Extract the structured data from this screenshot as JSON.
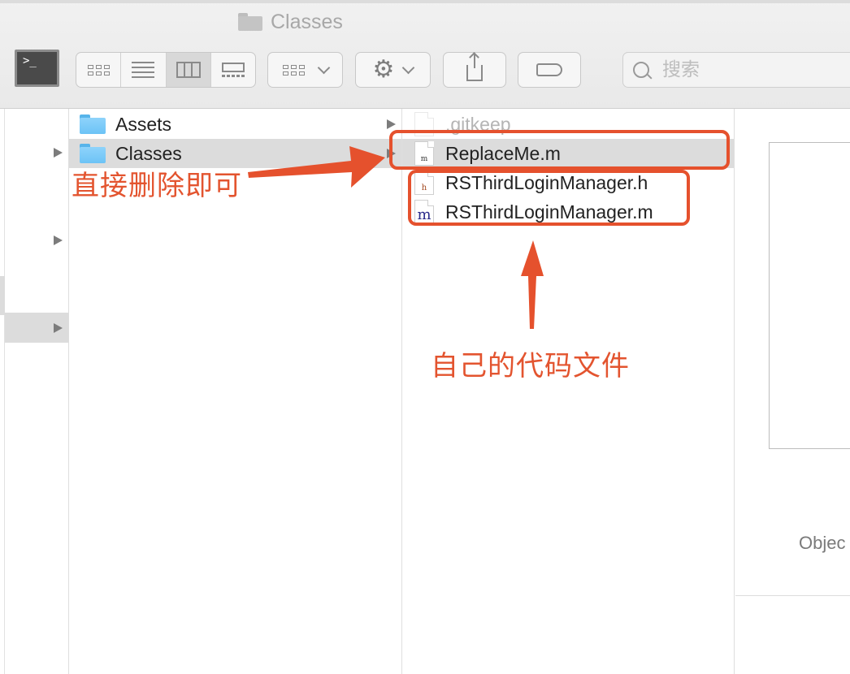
{
  "window": {
    "title": "Classes"
  },
  "toolbar": {
    "terminal_glyph": ">_",
    "search_placeholder": "搜索",
    "view_modes": [
      "icon-view",
      "list-view",
      "column-view",
      "gallery-view"
    ],
    "selected_view": "column-view"
  },
  "columns": {
    "parent": {
      "items": [
        {
          "label": "Assets",
          "icon": "folder-icon",
          "selected": false
        },
        {
          "label": "Classes",
          "icon": "folder-icon",
          "selected": true
        }
      ]
    },
    "current": {
      "items": [
        {
          "label": ".gitkeep",
          "icon": "file-icon",
          "badge": ""
        },
        {
          "label": "ReplaceMe.m",
          "icon": "file-icon",
          "badge": "m",
          "selected": true
        },
        {
          "label": "RSThirdLoginManager.h",
          "icon": "header-file-icon",
          "badge": "h"
        },
        {
          "label": "RSThirdLoginManager.m",
          "icon": "objc-file-icon",
          "badge": "m"
        }
      ]
    },
    "preview": {
      "kind_label": "Objec"
    }
  },
  "annotations": {
    "delete_note": "直接删除即可",
    "own_code_note": "自己的代码文件",
    "color": "#e5512d"
  }
}
